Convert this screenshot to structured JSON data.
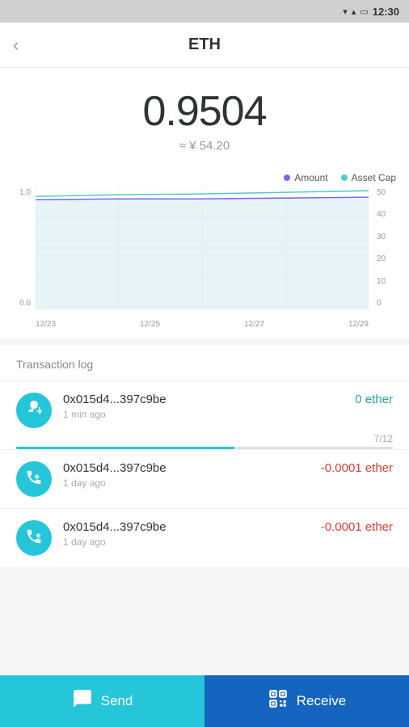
{
  "statusBar": {
    "time": "12:30",
    "icons": [
      "▼",
      "▲",
      "🔋"
    ]
  },
  "header": {
    "title": "ETH",
    "back_label": "‹"
  },
  "balance": {
    "amount": "0.9504",
    "fiat": "≈ ¥ 54.20"
  },
  "chart": {
    "legend": {
      "amount_label": "Amount",
      "asset_cap_label": "Asset Cap"
    },
    "y_axis_left": [
      "1.0",
      "",
      "",
      "",
      "0.0"
    ],
    "y_axis_right": [
      "50",
      "40",
      "30",
      "20",
      "10",
      "0"
    ],
    "x_axis": [
      "12/23",
      "12/25",
      "12/27",
      "12/29"
    ]
  },
  "transactions": {
    "header": "Transaction log",
    "items": [
      {
        "address": "0x015d4...397c9be",
        "time": "1 min ago",
        "amount": "0 ether",
        "amount_type": "zero",
        "has_progress": true,
        "progress_value": "7/12",
        "progress_pct": 58,
        "icon": "receive"
      },
      {
        "address": "0x015d4...397c9be",
        "time": "1 day ago",
        "amount": "-0.0001 ether",
        "amount_type": "neg",
        "has_progress": false,
        "icon": "call-in"
      },
      {
        "address": "0x015d4...397c9be",
        "time": "1 day ago",
        "amount": "-0.0001 ether",
        "amount_type": "neg",
        "has_progress": false,
        "icon": "call-out"
      }
    ]
  },
  "bottomNav": {
    "send_label": "Send",
    "receive_label": "Receive"
  }
}
